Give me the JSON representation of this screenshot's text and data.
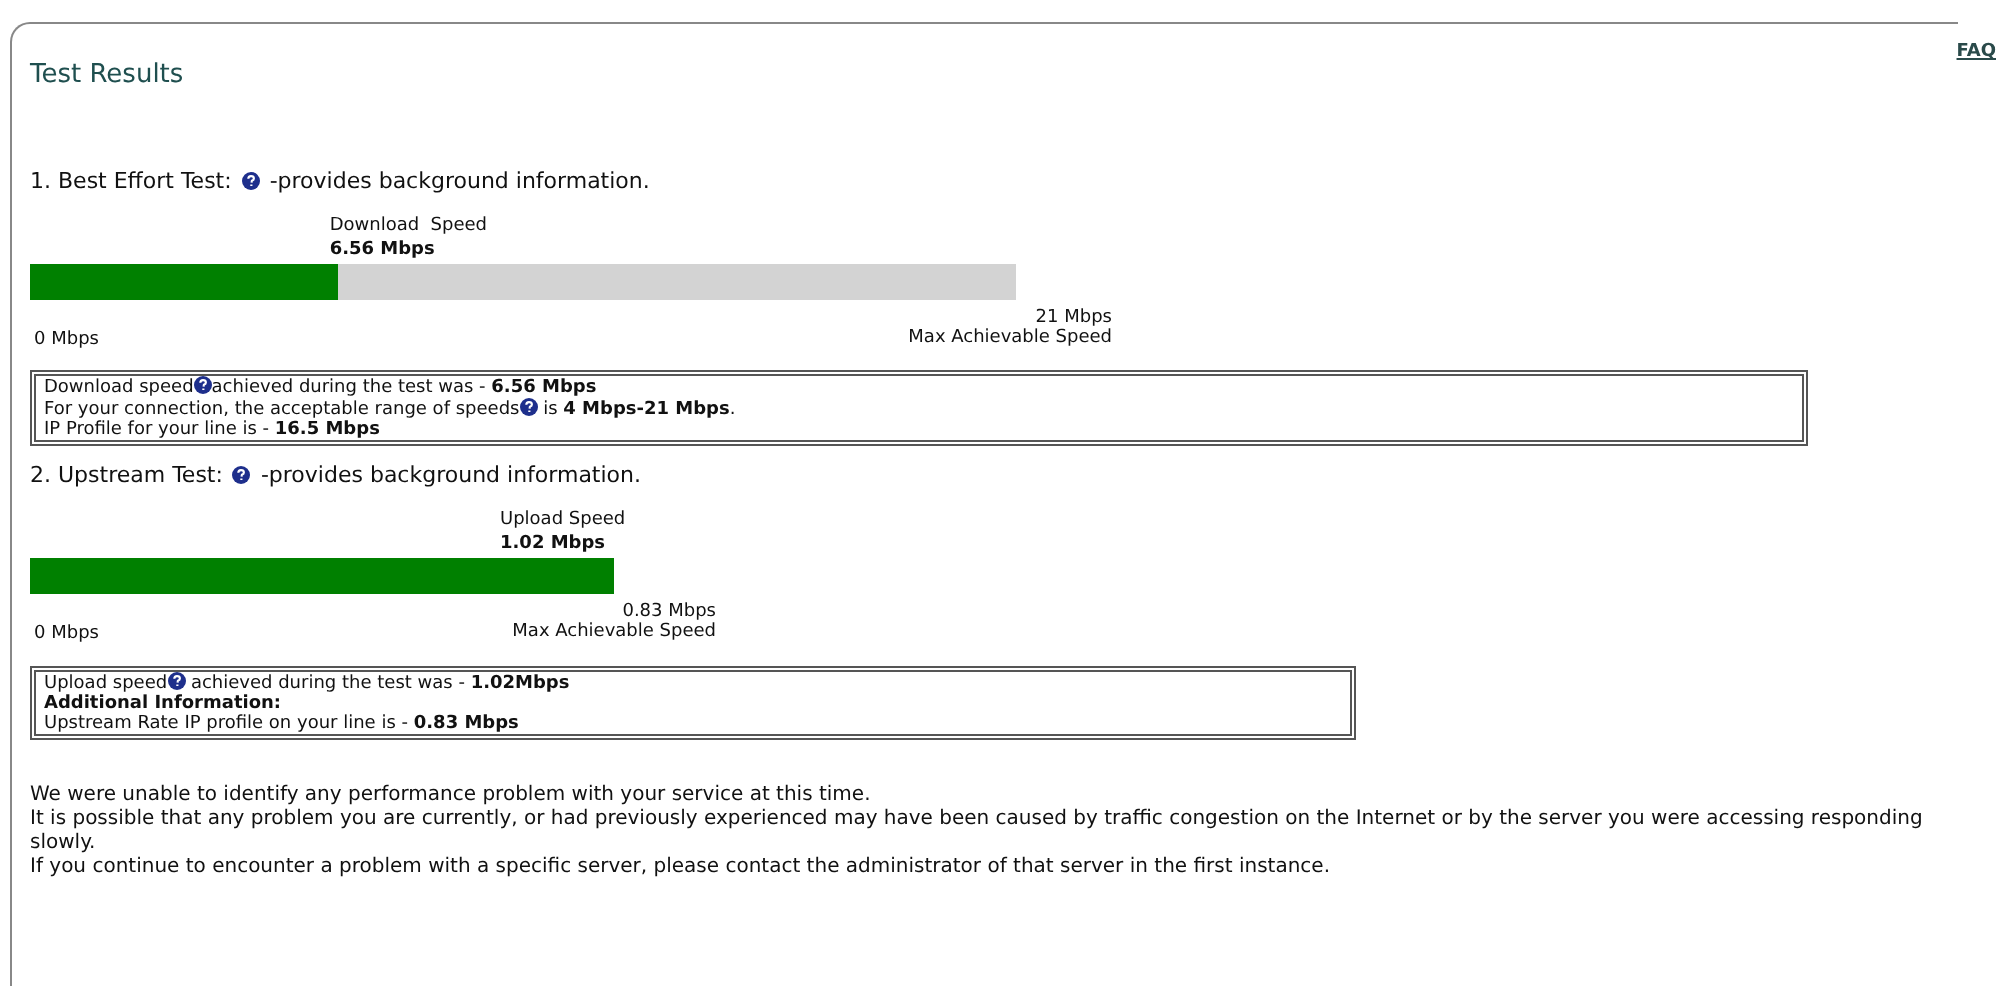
{
  "faq_link": "FAQ",
  "title": "Test Results",
  "tests": [
    {
      "number": "1.",
      "name": "Best Effort Test:",
      "help": true,
      "note": "-provides background information.",
      "gauge_label": "Download  Speed",
      "gauge_value": "6.56 Mbps",
      "level": 0.312,
      "min_label": "0 Mbps",
      "max_value": "21 Mbps",
      "max_label": "Max Achievable Speed",
      "info": [
        {
          "kind": "text",
          "before": "Download speed",
          "help": true,
          "after": "achieved during the test was - **6.56 Mbps**"
        },
        {
          "kind": "text",
          "before": "For your connection, the acceptable range of speeds",
          "help": true,
          "after": " is **4 Mbps-21 Mbps**."
        },
        {
          "kind": "text",
          "before": "IP Profile for your line is - **16.5 Mbps**",
          "help": false
        }
      ]
    },
    {
      "number": "2.",
      "name": "Upstream Test:",
      "help": true,
      "note": "-provides background information.",
      "gauge_label": "Upload Speed",
      "gauge_value": "1.02 Mbps",
      "level": 1,
      "min_label": "0 Mbps",
      "max_value": "0.83 Mbps",
      "max_label": "Max Achievable Speed",
      "info": [
        {
          "kind": "text",
          "before": "Upload speed",
          "help": true,
          "after": " achieved during the test was - **1.02Mbps**"
        },
        {
          "kind": "heading",
          "before": "Additional Information:",
          "help": false
        },
        {
          "kind": "text",
          "before": "Upstream Rate IP profile on your line is - **0.83 Mbps**",
          "help": false
        }
      ]
    }
  ],
  "summary": [
    "We were unable to identify any performance problem with your service at this time.",
    "It is possible that any problem you are currently, or had previously experienced may have been caused by traffic congestion on the Internet or by the server you were accessing responding slowly.",
    "If you continue to encounter a problem with a specific server, please contact the administrator of that server in the first instance."
  ]
}
